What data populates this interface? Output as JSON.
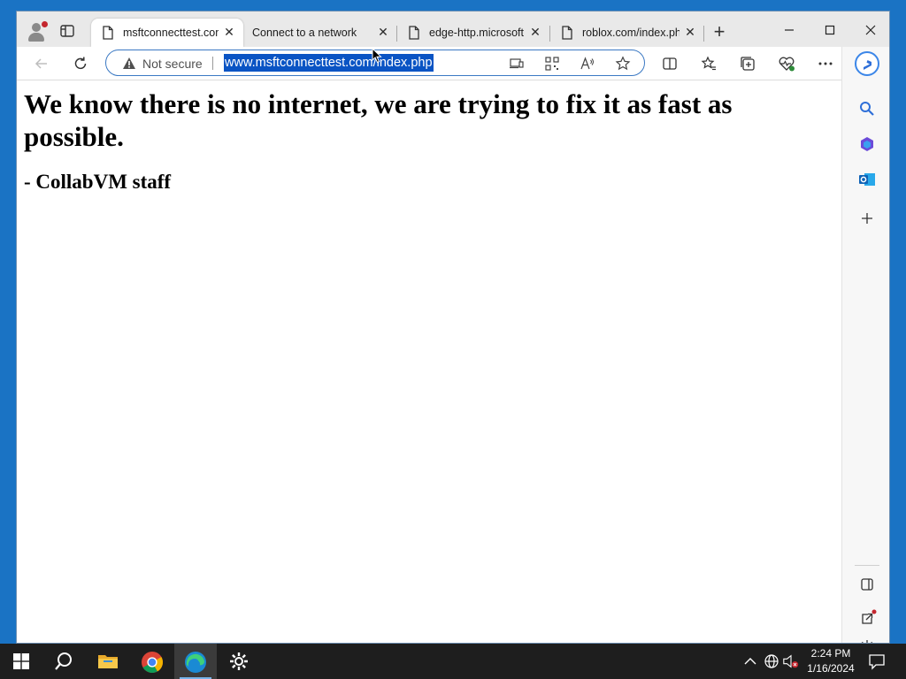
{
  "browser": {
    "tabs": [
      {
        "label": "msftconnecttest.com",
        "active": true
      },
      {
        "label": "Connect to a network",
        "active": false
      },
      {
        "label": "edge-http.microsoft.com",
        "active": false
      },
      {
        "label": "roblox.com/index.php",
        "active": false
      }
    ],
    "address": {
      "security_label": "Not secure",
      "url": "www.msftconnecttest.com/index.php"
    }
  },
  "page": {
    "heading": "We know there is no internet, we are trying to fix it as fast as possible.",
    "signature": "- CollabVM staff"
  },
  "taskbar": {
    "time": "2:24 PM",
    "date": "1/16/2024",
    "pinned": [
      "start",
      "search",
      "file-explorer",
      "chrome",
      "edge",
      "settings"
    ]
  },
  "colors": {
    "desktop": "#1a73c4",
    "selection": "#0a54c4",
    "taskbar": "#1e1e1e",
    "profile_badge": "#c4262e"
  }
}
